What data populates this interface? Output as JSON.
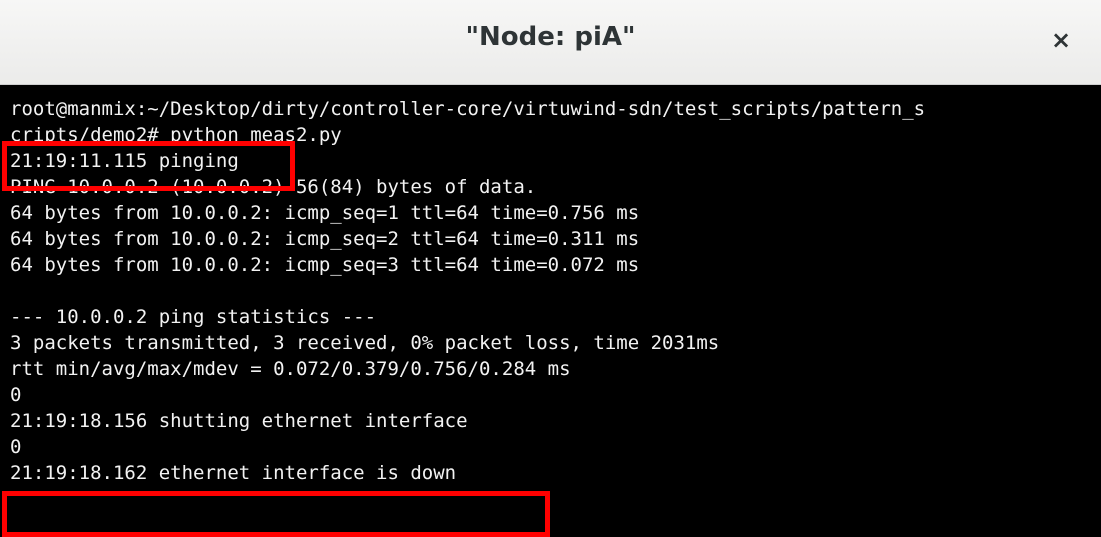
{
  "window": {
    "title": "\"Node: piA\"",
    "close_label": "×"
  },
  "terminal": {
    "lines": [
      "root@manmix:~/Desktop/dirty/controller-core/virtuwind-sdn/test_scripts/pattern_s",
      "cripts/demo2# python meas2.py",
      "21:19:11.115 pinging",
      "PING 10.0.0.2 (10.0.0.2) 56(84) bytes of data.",
      "64 bytes from 10.0.0.2: icmp_seq=1 ttl=64 time=0.756 ms",
      "64 bytes from 10.0.0.2: icmp_seq=2 ttl=64 time=0.311 ms",
      "64 bytes from 10.0.0.2: icmp_seq=3 ttl=64 time=0.072 ms",
      "",
      "--- 10.0.0.2 ping statistics ---",
      "3 packets transmitted, 3 received, 0% packet loss, time 2031ms",
      "rtt min/avg/max/mdev = 0.072/0.379/0.756/0.284 ms",
      "0",
      "21:19:18.156 shutting ethernet interface",
      "0",
      "21:19:18.162 ethernet interface is down"
    ]
  },
  "colors": {
    "highlight": "#ff0000",
    "terminal_bg": "#000000",
    "terminal_fg": "#f2f2f2"
  }
}
